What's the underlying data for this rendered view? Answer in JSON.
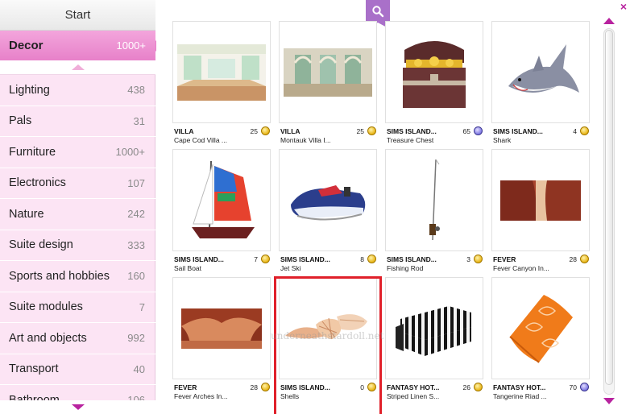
{
  "sidebar": {
    "start_label": "Start",
    "active": {
      "label": "Decor",
      "count": "1000+"
    },
    "items": [
      {
        "label": "Lighting",
        "count": "438"
      },
      {
        "label": "Pals",
        "count": "31"
      },
      {
        "label": "Furniture",
        "count": "1000+"
      },
      {
        "label": "Electronics",
        "count": "107"
      },
      {
        "label": "Nature",
        "count": "242"
      },
      {
        "label": "Suite design",
        "count": "333"
      },
      {
        "label": "Sports and hobbies",
        "count": "160"
      },
      {
        "label": "Suite modules",
        "count": "7"
      },
      {
        "label": "Art and objects",
        "count": "992"
      },
      {
        "label": "Transport",
        "count": "40"
      },
      {
        "label": "Bathroom",
        "count": "106"
      }
    ]
  },
  "header": {
    "close_label": "×"
  },
  "items": [
    {
      "brand": "VILLA",
      "name": "Cape Cod Villa ...",
      "price": "25",
      "currency": "coin"
    },
    {
      "brand": "VILLA",
      "name": "Montauk Villa I...",
      "price": "25",
      "currency": "coin"
    },
    {
      "brand": "SIMS ISLAND...",
      "name": "Treasure Chest",
      "price": "65",
      "currency": "vip"
    },
    {
      "brand": "SIMS ISLAND...",
      "name": "Shark",
      "price": "4",
      "currency": "coin"
    },
    {
      "brand": "SIMS ISLAND...",
      "name": "Sail Boat",
      "price": "7",
      "currency": "coin"
    },
    {
      "brand": "SIMS ISLAND...",
      "name": "Jet Ski",
      "price": "8",
      "currency": "coin"
    },
    {
      "brand": "SIMS ISLAND...",
      "name": "Fishing Rod",
      "price": "3",
      "currency": "coin"
    },
    {
      "brand": "FEVER",
      "name": "Fever Canyon In...",
      "price": "28",
      "currency": "coin"
    },
    {
      "brand": "FEVER",
      "name": "Fever Arches In...",
      "price": "28",
      "currency": "coin"
    },
    {
      "brand": "SIMS ISLAND...",
      "name": "Shells",
      "price": "0",
      "currency": "coin"
    },
    {
      "brand": "FANTASY HOT...",
      "name": "Striped Linen S...",
      "price": "26",
      "currency": "coin"
    },
    {
      "brand": "FANTASY HOT...",
      "name": "Tangerine Riad ...",
      "price": "70",
      "currency": "vip"
    }
  ],
  "watermark": "underneathstardoll.net",
  "colors": {
    "accent": "#b8239f",
    "active_tab": "#e781c9",
    "sidebar_bg": "#fce4f4",
    "search_tab": "#a970c9",
    "highlight": "#e0202a"
  }
}
